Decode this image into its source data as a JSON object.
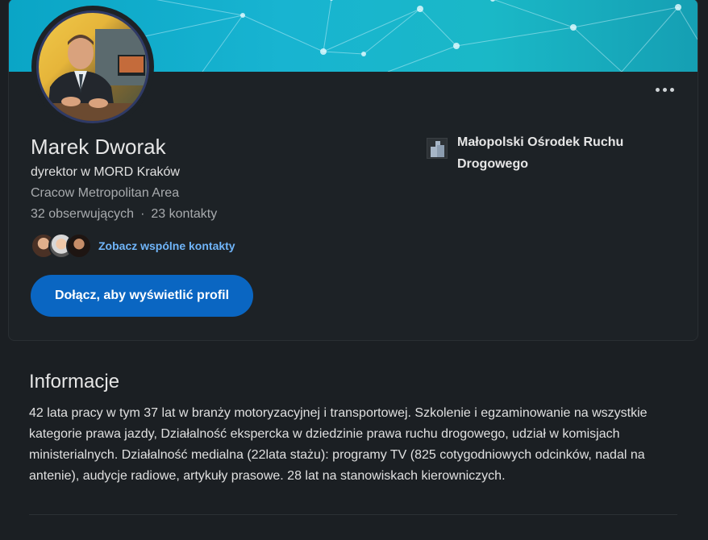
{
  "profile": {
    "name": "Marek Dworak",
    "headline": "dyrektor w MORD Kraków",
    "location": "Cracow Metropolitan Area",
    "followers": "32 obserwujących",
    "separator": "·",
    "connections": "23 kontakty",
    "mutual_link": "Zobacz wspólne kontakty",
    "join_button": "Dołącz, aby wyświetlić profil",
    "more_icon": "ellipsis-icon"
  },
  "company": {
    "name": "Małopolski Ośrodek Ruchu Drogowego",
    "logo_icon": "company-logo-icon"
  },
  "about": {
    "title": "Informacje",
    "text": "42 lata pracy w tym 37 lat w branży motoryzacyjnej i transportowej. Szkolenie i egzaminowanie na wszystkie kategorie prawa jazdy, Działalność ekspercka w dziedzinie prawa ruchu drogowego, udział w komisjach ministerialnych. Działalność medialna (22lata stażu): programy TV (825 cotygodniowych odcinków, nadal na antenie), audycje radiowe, artykuły prasowe. 28 lat na stanowiskach kierowniczych."
  },
  "colors": {
    "accent": "#0a66c2",
    "link": "#70b5f9",
    "background": "#1b1f23",
    "banner": "#16b0cf"
  }
}
